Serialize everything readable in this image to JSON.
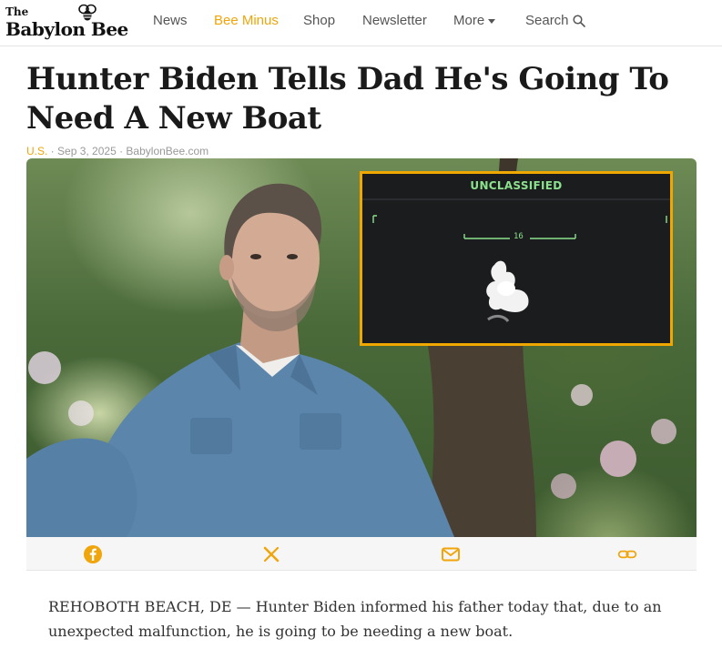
{
  "site": {
    "logo_the": "The",
    "logo_name": "Babylon Bee"
  },
  "nav": {
    "items": [
      "News",
      "Bee Minus",
      "Shop",
      "Newsletter",
      "More",
      "Search"
    ],
    "active_color": "#f0a50a"
  },
  "article": {
    "headline": "Hunter Biden Tells Dad He's Going To Need A New Boat",
    "category": "U.S.",
    "date": "Sep 3, 2025",
    "source": "BabylonBee.com",
    "separator": " · ",
    "overlay_label": "UNCLASSIFIED",
    "overlay_number": "16",
    "body": "REHOBOTH BEACH, DE — Hunter Biden informed his father today that, due to an unexpected malfunction, he is going to be needing a new boat."
  },
  "share": {
    "icons": [
      "facebook-icon",
      "x-icon",
      "email-icon",
      "link-icon"
    ],
    "color": "#f0a50a"
  },
  "colors": {
    "accent": "#f0a50a",
    "overlay_border": "#f0a800",
    "overlay_text": "#8de28e"
  }
}
